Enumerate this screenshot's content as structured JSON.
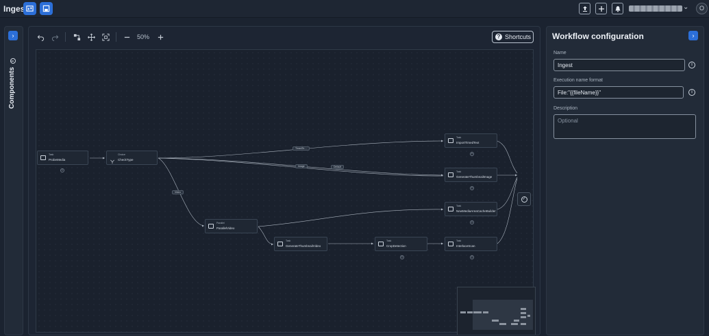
{
  "header": {
    "title": "Ingest",
    "mode_buttons": [
      "workflow-icon",
      "save-icon"
    ],
    "user_chevron": "⌄",
    "avatar_letter": "O"
  },
  "left_rail": {
    "label": "Components",
    "expand_glyph": "›",
    "info_glyph": "i"
  },
  "toolbar": {
    "zoom": "50%",
    "shortcuts_label": "Shortcuts",
    "shortcuts_glyph": "?"
  },
  "graph": {
    "task_type": "Task",
    "choice_type": "Choice",
    "parallel_type": "Parallel",
    "nodes": {
      "probe": "ProbeMedia",
      "check": "CheckType",
      "import": "ImportTimedText",
      "thumb_image": "GenerateThumbnailImage",
      "parallel": "ParallelVideo",
      "cache": "NewMediaAreaCacheBuilder",
      "thumb_video": "GenerateThumbnailVideo",
      "crop": "CropDetection",
      "interlace": "InterlaceScan"
    },
    "edge_labels": {
      "timed": "TimedTe…",
      "image": "Image",
      "default": "Default",
      "video": "Video"
    },
    "plus_glyph": "+",
    "end_glyph": "✓"
  },
  "config_panel": {
    "title": "Workflow configuration",
    "collapse_glyph": "›",
    "name_label": "Name",
    "name_value": "Ingest",
    "exec_label": "Execution name format",
    "exec_value": "File:\"{{fileName}}\"",
    "desc_label": "Description",
    "desc_placeholder": "Optional",
    "info_glyph": "i"
  }
}
